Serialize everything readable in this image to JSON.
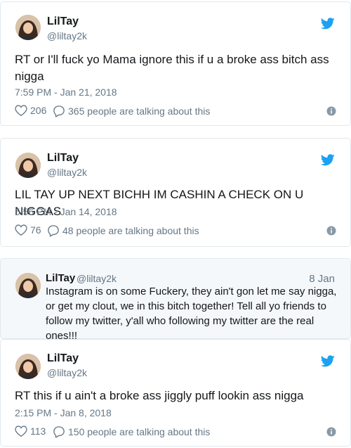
{
  "tweets": [
    {
      "name": "LilTay",
      "handle": "@liltay2k",
      "text": "RT or I'll fuck yo Mama ignore this if u a broke ass bitch ass nigga",
      "time": "7:59 PM - Jan 21, 2018",
      "likes": "206",
      "talking": "365 people are talking about this"
    },
    {
      "name": "LilTay",
      "handle": "@liltay2k",
      "text": "LIL TAY UP NEXT BICHH IM CASHIN A CHECK ON U NIGGAS",
      "time": "5:56 PM - Jan 14, 2018",
      "likes": "76",
      "talking": "48 people are talking about this"
    },
    {
      "name": "LilTay",
      "handle": "@liltay2k",
      "date": "8 Jan",
      "text": "Instagram is on some Fuckery, they ain't gon let me say nigga, or get my clout, we in this bitch together! Tell all yo friends to follow my twitter, y'all who following my twitter are the real ones!!!"
    },
    {
      "name": "LilTay",
      "handle": "@liltay2k",
      "text": "RT this if u ain't a broke ass jiggly puff lookin ass nigga",
      "time": "2:15 PM - Jan 8, 2018",
      "likes": "113",
      "talking": "150 people are talking about this"
    }
  ],
  "icons": {
    "bird": "twitter-bird-icon",
    "heart": "heart-icon",
    "reply": "speech-bubble-icon",
    "info": "info-icon"
  },
  "colors": {
    "twitter_blue": "#1da1f2",
    "text": "#14171a",
    "secondary": "#657786",
    "border": "#e1e8ed",
    "quoted_bg": "#f5f8fa"
  }
}
